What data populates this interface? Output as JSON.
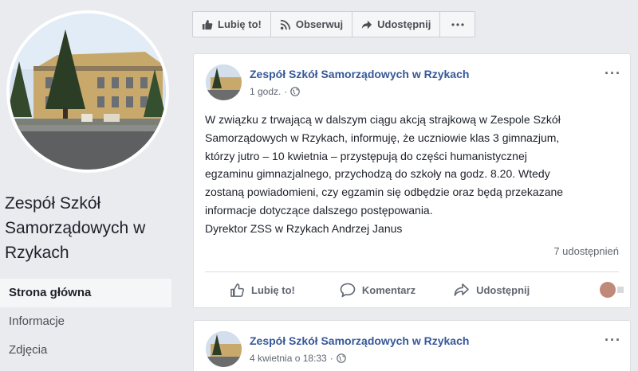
{
  "page": {
    "name": "Zespół Szkół Samorządowych w Rzykach"
  },
  "nav": [
    {
      "label": "Strona główna",
      "active": true
    },
    {
      "label": "Informacje",
      "active": false
    },
    {
      "label": "Zdjęcia",
      "active": false
    }
  ],
  "actionbar": {
    "like": "Lubię to!",
    "follow": "Obserwuj",
    "share": "Udostępnij",
    "more_icon": "ellipsis-icon"
  },
  "posts": [
    {
      "author": "Zespół Szkół Samorządowych w Rzykach",
      "time": "1 godz.",
      "text_lines": [
        "W związku z trwającą w dalszym ciągu akcją strajkową w Zespole Szkół",
        "Samorządowych w Rzykach, informuję, że uczniowie klas 3 gimnazjum,",
        "którzy jutro – 10 kwietnia – przystępują do części humanistycznej",
        "egzaminu gimnazjalnego, przychodzą do szkoły na godz. 8.20. Wtedy",
        "zostaną powiadomieni, czy egzamin się odbędzie oraz będą przekazane",
        "informacje dotyczące dalszego postępowania.",
        "Dyrektor ZSS w Rzykach Andrzej Janus"
      ],
      "shares": "7 udostępnień",
      "actions": {
        "like": "Lubię to!",
        "comment": "Komentarz",
        "share": "Udostępnij"
      }
    },
    {
      "author": "Zespół Szkół Samorządowych w Rzykach",
      "time": "4 kwietnia o 18:33"
    }
  ],
  "colors": {
    "link": "#365899",
    "background": "#e9ebee"
  }
}
